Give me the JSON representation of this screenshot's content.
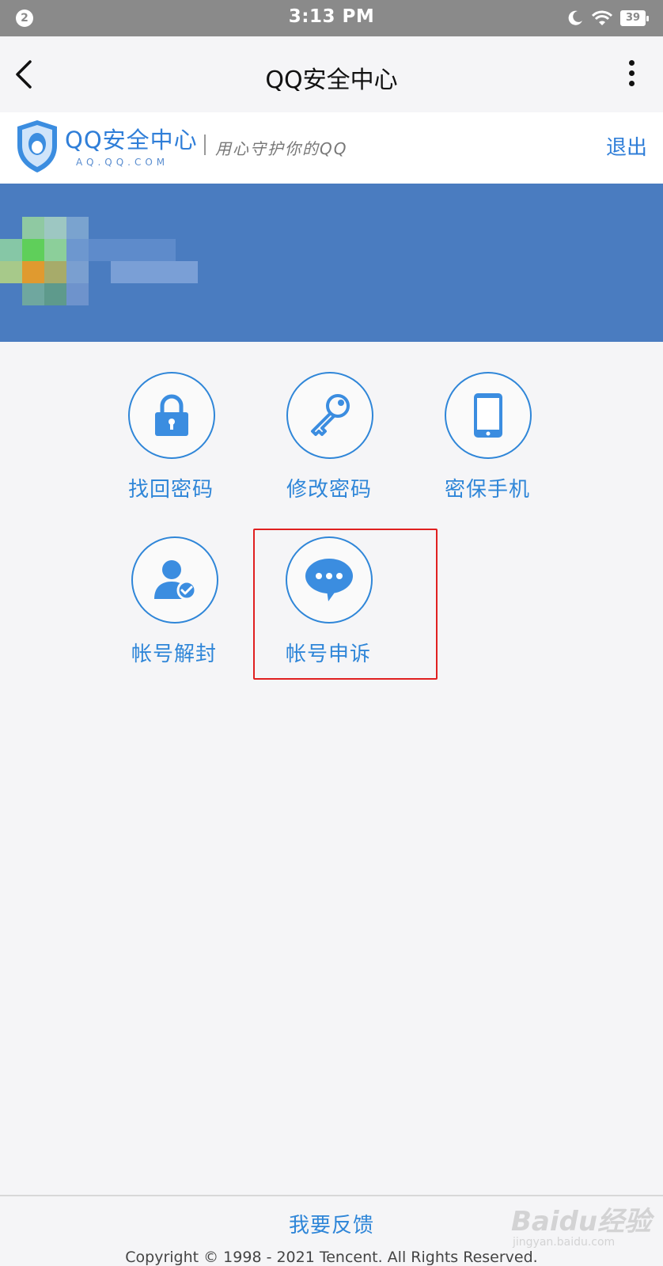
{
  "status_bar": {
    "notification_count": "2",
    "time": "3:13 PM",
    "battery": "39",
    "icons": [
      "moon-icon",
      "wifi-icon",
      "battery-icon"
    ]
  },
  "title_bar": {
    "title": "QQ安全中心",
    "back_icon": "chevron-left-icon",
    "more_icon": "more-vertical-icon"
  },
  "brand": {
    "name": "QQ安全中心",
    "domain": "AQ.QQ.COM",
    "slogan": "用心守护你的QQ",
    "logout_label": "退出"
  },
  "grid": {
    "items": [
      {
        "label": "找回密码",
        "icon": "lock-icon"
      },
      {
        "label": "修改密码",
        "icon": "key-icon"
      },
      {
        "label": "密保手机",
        "icon": "phone-icon"
      },
      {
        "label": "帐号解封",
        "icon": "user-check-icon"
      },
      {
        "label": "帐号申诉",
        "icon": "chat-bubble-icon",
        "highlighted": true
      }
    ]
  },
  "footer": {
    "feedback_label": "我要反馈",
    "copyright": "Copyright © 1998 - 2021 Tencent. All Rights Reserved."
  },
  "watermark": {
    "brand": "Baidu经验",
    "url": "jingyan.baidu.com"
  },
  "colors": {
    "accent": "#2f86d8",
    "profile_band": "#4a7cc0",
    "highlight_border": "#e02020",
    "status_bar": "#8a8a8a"
  }
}
